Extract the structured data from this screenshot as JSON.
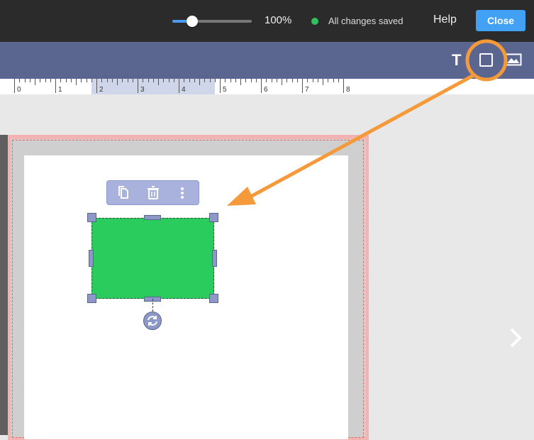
{
  "topbar": {
    "zoom_label": "100%",
    "zoom_percent": 25,
    "status_text": "All changes saved",
    "status_color": "#2ec05c",
    "help_label": "Help",
    "close_label": "Close",
    "accent_color": "#42a0f5"
  },
  "toolbar": {
    "tools": [
      {
        "icon": "text-tool-icon",
        "label": "T"
      },
      {
        "icon": "shape-tool-icon"
      },
      {
        "icon": "image-tool-icon"
      }
    ],
    "background_color": "#5a6690"
  },
  "ruler": {
    "numbers": [
      "0",
      "1",
      "2",
      "3",
      "4",
      "5",
      "6",
      "7",
      "8"
    ]
  },
  "canvas": {
    "shape_color": "#2bcc5e",
    "object_toolbar_icons": [
      "duplicate-icon",
      "trash-icon",
      "more-icon"
    ]
  },
  "annotation": {
    "color": "#f59a3a"
  }
}
